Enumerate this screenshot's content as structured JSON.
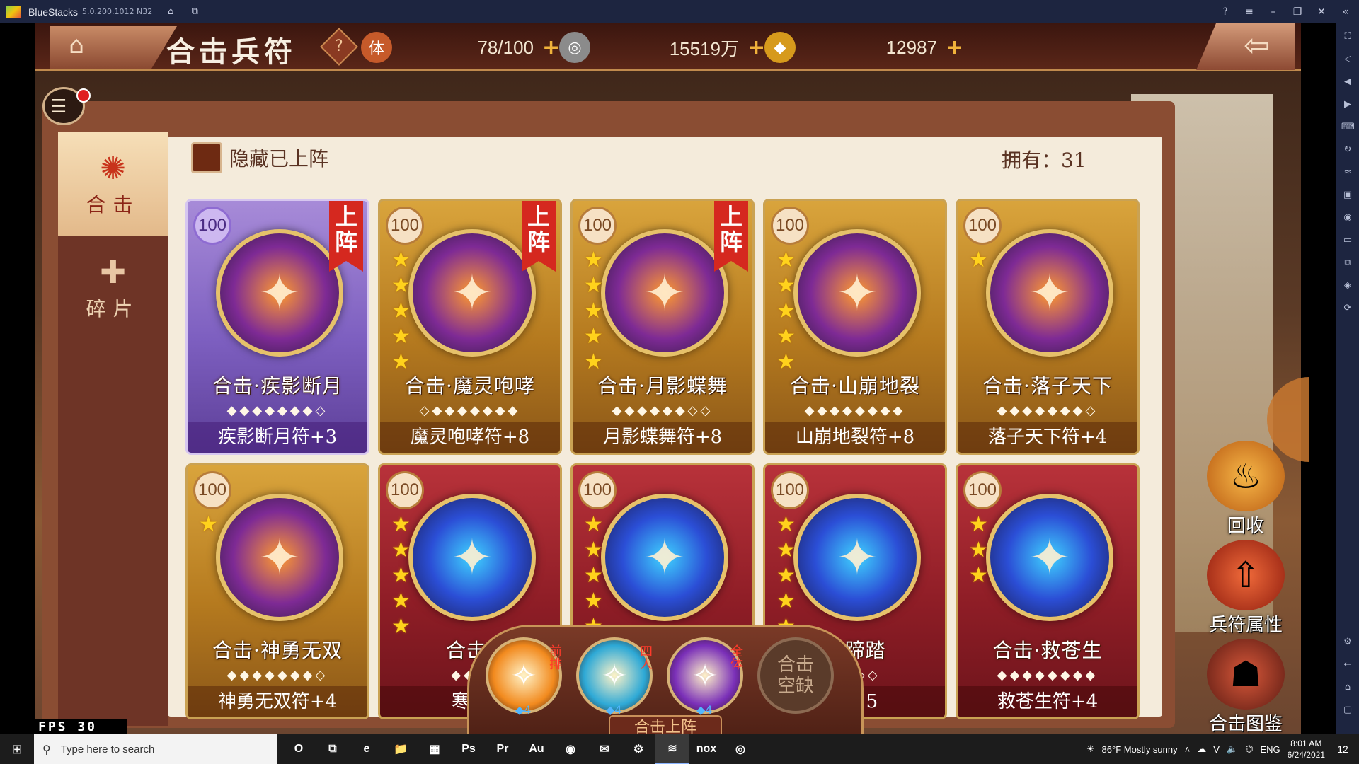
{
  "window": {
    "app_name": "BlueStacks",
    "version": "5.0.200.1012 N32"
  },
  "game": {
    "title": "合击兵符",
    "help_label": "?",
    "resources": [
      {
        "name": "stamina",
        "icon_text": "体",
        "value": "78/100",
        "color": "#c65a2a"
      },
      {
        "name": "silver",
        "icon_text": "◎",
        "value": "15519万",
        "color": "#9a9a9a"
      },
      {
        "name": "gold",
        "icon_text": "◆",
        "value": "12987",
        "color": "#e0a21d"
      }
    ],
    "plus_label": "+",
    "tabs": [
      {
        "label": "合击",
        "icon": "flame-icon"
      },
      {
        "label": "碎片",
        "icon": "puzzle-icon"
      }
    ],
    "hide_deployed_label": "隐藏已上阵",
    "owned_label": "拥有：31",
    "deployed_badge": "上阵",
    "cards": [
      {
        "level": "100",
        "name": "合击·疾影断月",
        "item": "疾影断月符+3",
        "style": "purple",
        "stars": 0,
        "deployed": true,
        "dots": "◆◆◆◆◆◆◆◇"
      },
      {
        "level": "100",
        "name": "合击·魔灵咆哮",
        "item": "魔灵咆哮符+8",
        "style": "gold",
        "stars": 5,
        "deployed": true,
        "dots": "◇◆◆◆◆◆◆◆"
      },
      {
        "level": "100",
        "name": "合击·月影蝶舞",
        "item": "月影蝶舞符+8",
        "style": "gold",
        "stars": 5,
        "deployed": true,
        "dots": "◆◆◆◆◆◆◇◇"
      },
      {
        "level": "100",
        "name": "合击·山崩地裂",
        "item": "山崩地裂符+8",
        "style": "gold",
        "stars": 5,
        "deployed": false,
        "dots": "◆◆◆◆◆◆◆◆"
      },
      {
        "level": "100",
        "name": "合击·落子天下",
        "item": "落子天下符+4",
        "style": "gold",
        "stars": 1,
        "deployed": false,
        "dots": "◆◆◆◆◆◆◆◇"
      },
      {
        "level": "100",
        "name": "合击·神勇无双",
        "item": "神勇无双符+4",
        "style": "gold",
        "stars": 1,
        "deployed": false,
        "dots": "◆◆◆◆◆◆◆◇"
      },
      {
        "level": "100",
        "name": "合击·",
        "item": "寒冰",
        "style": "red",
        "stars": 5,
        "deployed": false,
        "dots": "◆◆◆"
      },
      {
        "level": "100",
        "name": "",
        "item": "",
        "style": "red",
        "stars": 5,
        "deployed": false,
        "dots": ""
      },
      {
        "level": "100",
        "name": "铁蹄踏",
        "item": "符+5",
        "style": "red",
        "stars": 5,
        "deployed": false,
        "dots": "◇◇◇◇"
      },
      {
        "level": "100",
        "name": "合击·救苍生",
        "item": "救苍生符+4",
        "style": "red",
        "stars": 3,
        "deployed": false,
        "dots": "◆◆◆◆◆◆◆◆"
      }
    ],
    "lineup": {
      "label": "合击上阵",
      "slots": [
        {
          "tag": "前排",
          "gem": "◆4",
          "color": "#f28a1e",
          "icon": "slash-icon"
        },
        {
          "tag": "四人",
          "gem": "◆4",
          "color": "#2ea9d6",
          "icon": "dancer-icon"
        },
        {
          "tag": "全体",
          "gem": "◆4",
          "color": "#7a2fb8",
          "icon": "demon-icon"
        },
        {
          "empty_label": "合击空缺"
        }
      ]
    },
    "side_buttons": [
      {
        "label": "回收",
        "icon": "recycle-cauldron-icon",
        "color": "#d67a1e"
      },
      {
        "label": "兵符属性",
        "icon": "upgrade-arrow-icon",
        "color": "#c8351c"
      },
      {
        "label": "合击图鉴",
        "icon": "codex-icon",
        "color": "#8a2a2a"
      }
    ],
    "fps_label": "FPS 30"
  },
  "taskbar": {
    "search_placeholder": "Type here to search",
    "apps": [
      "O",
      "⧉",
      "e",
      "📁",
      "▦",
      "Ps",
      "Pr",
      "Au",
      "◉",
      "✉",
      "⚙",
      "≋",
      "nox",
      "◎"
    ],
    "weather": "86°F  Mostly sunny",
    "lang": "ENG",
    "time": "8:01 AM",
    "date": "6/24/2021",
    "notifications": "12"
  }
}
